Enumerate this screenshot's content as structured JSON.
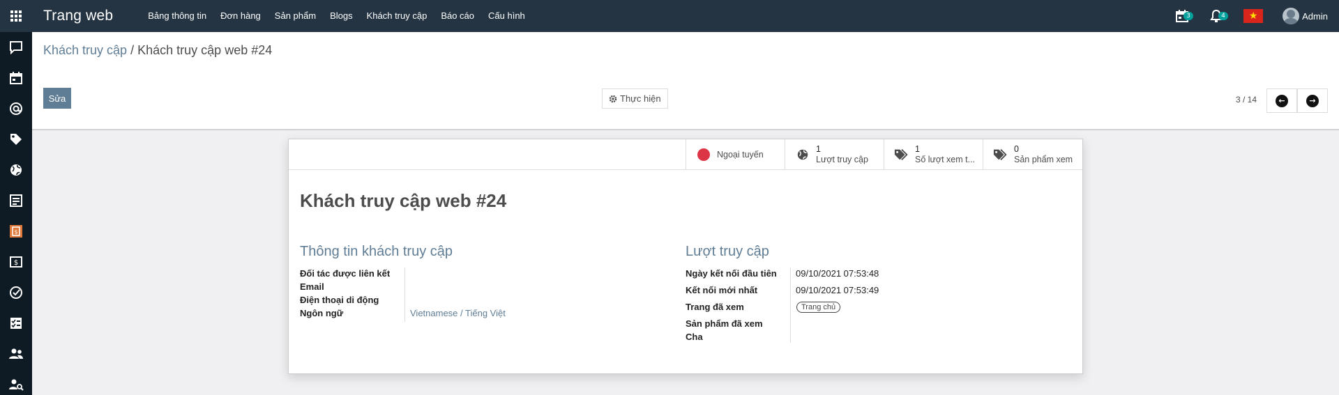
{
  "navbar": {
    "app_title": "Trang web",
    "menu": [
      "Bảng thông tin",
      "Đơn hàng",
      "Sản phẩm",
      "Blogs",
      "Khách truy cập",
      "Báo cáo",
      "Cấu hình"
    ],
    "activity_count": "3",
    "notification_count": "4",
    "user_name": "Admin"
  },
  "sidebar_icons": [
    "chat-icon",
    "calendar-icon",
    "at-sign-icon",
    "tag-icon",
    "globe-icon",
    "document-icon",
    "invoice-icon",
    "money-icon",
    "check-circle-icon",
    "checklist-icon",
    "users-icon",
    "user-search-icon"
  ],
  "breadcrumb": {
    "parent": "Khách truy cập",
    "separator": "/",
    "current": "Khách truy cập web #24"
  },
  "buttons": {
    "edit": "Sửa",
    "action": "Thực hiện"
  },
  "pager": {
    "value": "3 / 14"
  },
  "smart_buttons": {
    "status": "Ngoại tuyến",
    "visits_count": "1",
    "visits_label": "Lượt truy cập",
    "page_views_count": "1",
    "page_views_label": "Số lượt xem t...",
    "products_count": "0",
    "products_label": "Sản phẩm xem"
  },
  "record": {
    "title": "Khách truy cập web #24"
  },
  "visitor_info": {
    "title": "Thông tin khách truy cập",
    "labels": {
      "partner": "Đối tác được liên kết",
      "email": "Email",
      "mobile": "Điện thoại di động",
      "language": "Ngôn ngữ"
    },
    "language_value": "Vietnamese / Tiếng Việt"
  },
  "visits": {
    "title": "Lượt truy cập",
    "labels": {
      "first_connection": "Ngày kết nối đầu tiên",
      "last_connection": "Kết nối mới nhất",
      "visited_pages": "Trang đã xem",
      "viewed_products": "Sản phẩm đã xem",
      "parent": "Cha"
    },
    "first_connection_value": "09/10/2021 07:53:48",
    "last_connection_value": "09/10/2021 07:53:49",
    "visited_page_tag": "Trang chủ"
  }
}
